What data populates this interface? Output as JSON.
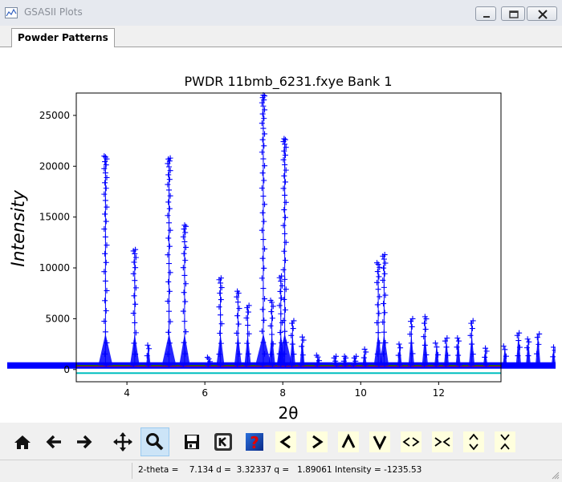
{
  "window": {
    "title": "GSASII Plots"
  },
  "tabs": [
    {
      "label": "Powder Patterns"
    }
  ],
  "chart_data": {
    "type": "scatter",
    "title": "PWDR 11bmb_6231.fxye Bank 1",
    "xlabel": "2θ",
    "ylabel": "Intensity",
    "xlim": [
      2.7,
      13.6
    ],
    "ylim": [
      -1200,
      27200
    ],
    "x_ticks": [
      4,
      6,
      8,
      10,
      12
    ],
    "x_tick_labels": [
      "4",
      "6",
      "8",
      "10",
      "12"
    ],
    "y_ticks": [
      0,
      5000,
      10000,
      15000,
      20000,
      25000
    ],
    "y_tick_labels": [
      "0",
      "5000",
      "10000",
      "15000",
      "20000",
      "25000"
    ],
    "grid": false,
    "background_level": 400,
    "peaks": [
      {
        "x": 3.45,
        "height": 21000
      },
      {
        "x": 4.2,
        "height": 11800
      },
      {
        "x": 4.55,
        "height": 2400
      },
      {
        "x": 5.08,
        "height": 20800
      },
      {
        "x": 5.48,
        "height": 14200
      },
      {
        "x": 6.1,
        "height": 1200
      },
      {
        "x": 6.4,
        "height": 9000
      },
      {
        "x": 6.85,
        "height": 7700
      },
      {
        "x": 7.1,
        "height": 6300
      },
      {
        "x": 7.5,
        "height": 27000
      },
      {
        "x": 7.72,
        "height": 6800
      },
      {
        "x": 7.95,
        "height": 9200
      },
      {
        "x": 8.05,
        "height": 22700
      },
      {
        "x": 8.25,
        "height": 4800
      },
      {
        "x": 8.5,
        "height": 3200
      },
      {
        "x": 8.9,
        "height": 1400
      },
      {
        "x": 9.35,
        "height": 1300
      },
      {
        "x": 9.6,
        "height": 1300
      },
      {
        "x": 9.85,
        "height": 1300
      },
      {
        "x": 10.1,
        "height": 2000
      },
      {
        "x": 10.45,
        "height": 10500
      },
      {
        "x": 10.6,
        "height": 11300
      },
      {
        "x": 11.0,
        "height": 2500
      },
      {
        "x": 11.3,
        "height": 5000
      },
      {
        "x": 11.65,
        "height": 5200
      },
      {
        "x": 11.95,
        "height": 2600
      },
      {
        "x": 12.2,
        "height": 3100
      },
      {
        "x": 12.5,
        "height": 3100
      },
      {
        "x": 12.85,
        "height": 4800
      },
      {
        "x": 13.2,
        "height": 2100
      }
    ],
    "overflow_peaks": [
      {
        "x": 13.7,
        "height": 2300
      },
      {
        "x": 14.05,
        "height": 3600
      },
      {
        "x": 14.3,
        "height": 3000
      },
      {
        "x": 14.55,
        "height": 3500
      },
      {
        "x": 14.95,
        "height": 2200
      },
      {
        "x": 15.25,
        "height": 2200
      }
    ],
    "series": [
      {
        "role": "observed",
        "marker": "+",
        "color": "#0000ff"
      },
      {
        "role": "calculated",
        "color": "#008000"
      },
      {
        "role": "background",
        "color": "#ff0000"
      },
      {
        "role": "difference",
        "color": "#00bfbf",
        "y": -350
      }
    ]
  },
  "toolbar": {
    "buttons": [
      {
        "icon": "home-icon"
      },
      {
        "icon": "back-arrow-icon"
      },
      {
        "icon": "forward-arrow-icon"
      },
      {
        "icon": "pan-icon"
      },
      {
        "icon": "zoom-icon",
        "active": true
      },
      {
        "icon": "save-icon"
      },
      {
        "icon": "key-icon"
      },
      {
        "icon": "help-icon"
      },
      {
        "icon": "shift-left-icon",
        "label": "<"
      },
      {
        "icon": "shift-right-icon",
        "label": ">"
      },
      {
        "icon": "shift-up-icon",
        "label": "Λ"
      },
      {
        "icon": "shift-down-icon",
        "label": "V"
      },
      {
        "icon": "expand-horizontal-icon",
        "label": "<>"
      },
      {
        "icon": "contract-horizontal-icon",
        "label": "><"
      },
      {
        "icon": "expand-vertical-icon"
      },
      {
        "icon": "contract-vertical-icon"
      }
    ]
  },
  "status": {
    "text": "2-theta =    7.134 d =  3.32337 q =   1.89061 Intensity = -1235.53"
  },
  "colors": {
    "observed": "#0000ff",
    "active_button": "#cce4f7",
    "chrome": "#f0f0f0"
  }
}
